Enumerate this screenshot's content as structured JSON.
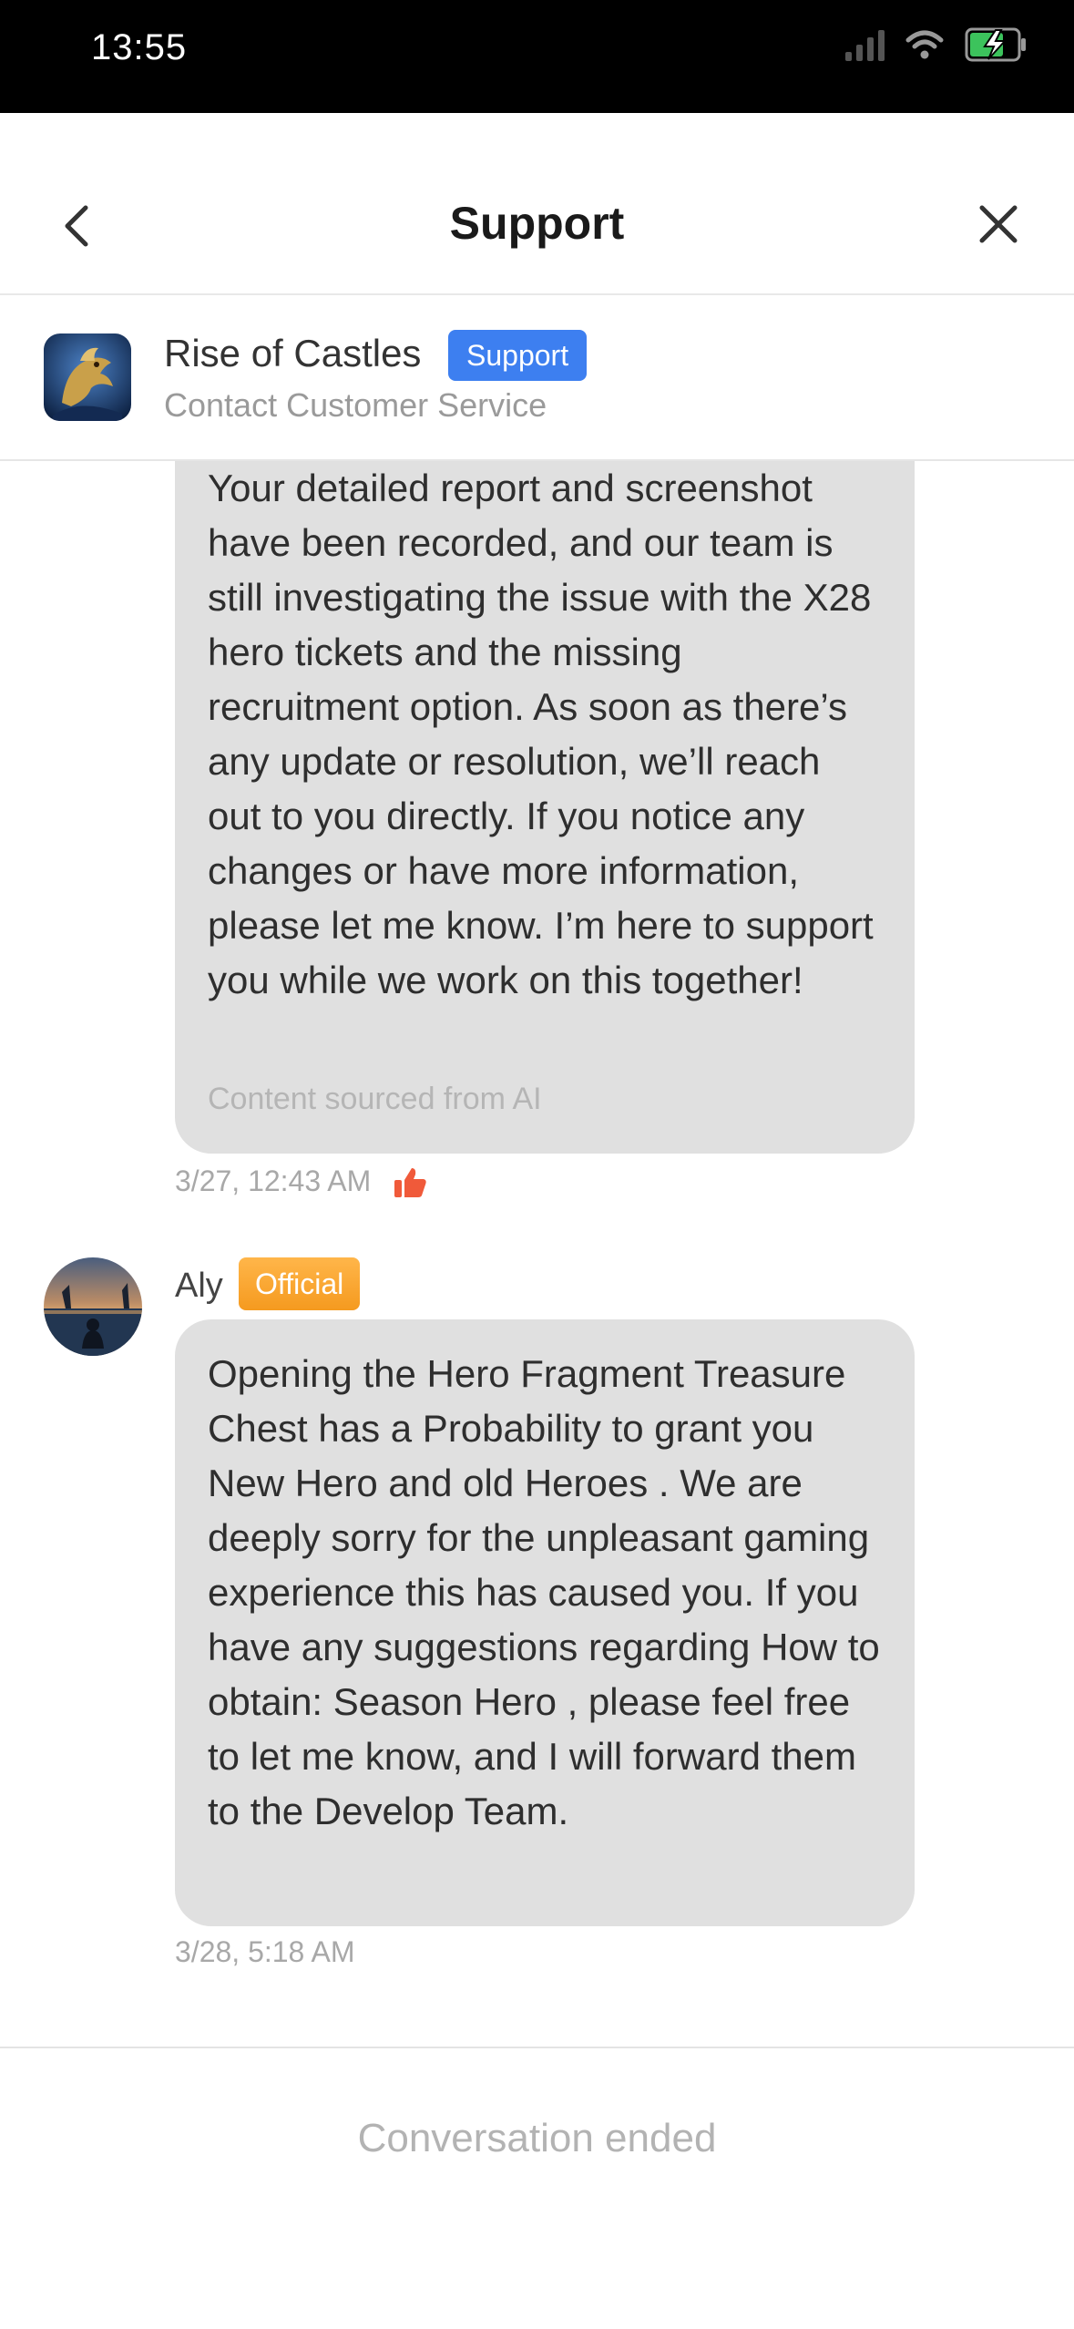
{
  "status_bar": {
    "time": "13:55"
  },
  "header": {
    "title": "Support",
    "back_icon": "chevron-left-icon",
    "close_icon": "close-icon"
  },
  "game": {
    "name": "Rise of Castles",
    "badge": "Support",
    "subtitle": "Contact Customer Service",
    "badge_color": "#3d7ff0"
  },
  "messages": [
    {
      "text": "Your detailed report and screenshot have been recorded, and our team is still investigating the issue with the X28 hero tickets and the missing recruitment option. As soon as there’s any update or resolution, we’ll reach out to you directly. If you notice any changes or have more information, please let me know. I’m here to support you while we work on this together!",
      "note": "Content sourced from AI",
      "time": "3/27, 12:43 AM"
    },
    {
      "sender": "Aly",
      "badge": "Official",
      "text": "Opening the Hero Fragment Treasure Chest has a Probability to grant you New Hero and old Heroes . We are deeply sorry for the unpleasant gaming experience this has caused you. If you have any suggestions regarding How to obtain: Season Hero , please feel free to let me know, and I will forward them to the Develop Team.",
      "time": "3/28, 5:18 AM"
    }
  ],
  "footer": {
    "status": "Conversation ended"
  }
}
